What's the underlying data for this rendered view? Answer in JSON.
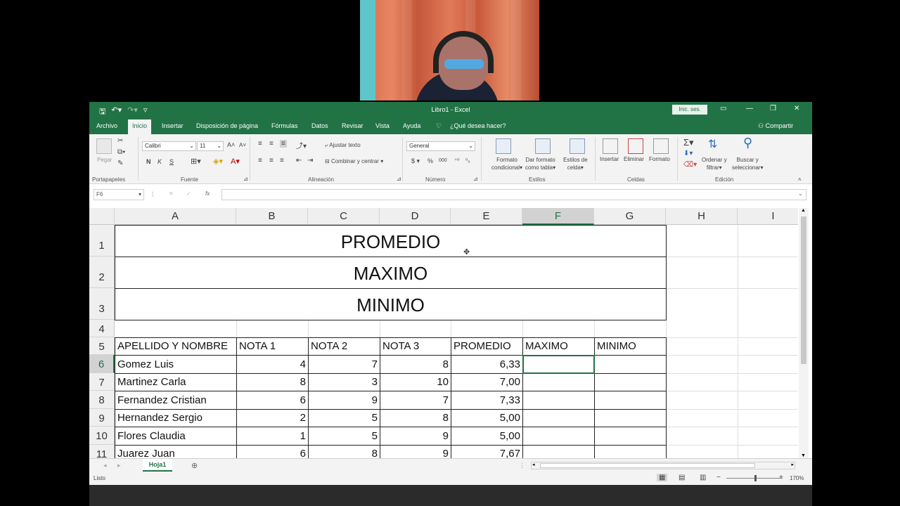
{
  "window": {
    "title": "Libro1 - Excel",
    "signin": "Inic. ses."
  },
  "tabs": [
    {
      "label": "Archivo"
    },
    {
      "label": "Inicio"
    },
    {
      "label": "Insertar"
    },
    {
      "label": "Disposición de página"
    },
    {
      "label": "Fórmulas"
    },
    {
      "label": "Datos"
    },
    {
      "label": "Revisar"
    },
    {
      "label": "Vista"
    },
    {
      "label": "Ayuda"
    },
    {
      "label": "¿Qué desea hacer?"
    }
  ],
  "share": "Compartir",
  "ribbon": {
    "clipboard": {
      "paste": "Pegar",
      "label": "Portapapeles"
    },
    "font": {
      "family": "Calibri",
      "size": "11",
      "bold": "N",
      "italic": "K",
      "underline": "S",
      "label": "Fuente"
    },
    "alignment": {
      "wrap": "Ajustar texto",
      "merge": "Combinar y centrar",
      "label": "Alineación"
    },
    "number": {
      "format": "General",
      "label": "Número"
    },
    "styles": {
      "conditional": [
        "Formato",
        "condicional"
      ],
      "table": [
        "Dar formato",
        "como tabla"
      ],
      "cell": [
        "Estilos de",
        "celda"
      ],
      "label": "Estilos"
    },
    "cells": {
      "insert": "Insertar",
      "delete": "Eliminar",
      "format": "Formato",
      "label": "Celdas"
    },
    "editing": {
      "sort": [
        "Ordenar y",
        "filtrar"
      ],
      "find": [
        "Buscar y",
        "seleccionar"
      ],
      "label": "Edición"
    }
  },
  "formula_bar": {
    "name_box": "F6",
    "formula": ""
  },
  "columns": [
    "A",
    "B",
    "C",
    "D",
    "E",
    "F",
    "G",
    "H",
    "I"
  ],
  "selected_cell": "F6",
  "merged": {
    "r1": "PROMEDIO",
    "r2": "MAXIMO",
    "r3": "MINIMO"
  },
  "table": {
    "headers": [
      "APELLIDO Y NOMBRE",
      "NOTA 1",
      "NOTA 2",
      "NOTA 3",
      "PROMEDIO",
      "MAXIMO",
      "MINIMO"
    ],
    "rows": [
      {
        "name": "Gomez Luis",
        "n1": "4",
        "n2": "7",
        "n3": "8",
        "prom": "6,33"
      },
      {
        "name": "Martinez Carla",
        "n1": "8",
        "n2": "3",
        "n3": "10",
        "prom": "7,00"
      },
      {
        "name": "Fernandez Cristian",
        "n1": "6",
        "n2": "9",
        "n3": "7",
        "prom": "7,33"
      },
      {
        "name": "Hernandez Sergio",
        "n1": "2",
        "n2": "5",
        "n3": "8",
        "prom": "5,00"
      },
      {
        "name": "Flores Claudia",
        "n1": "1",
        "n2": "5",
        "n3": "9",
        "prom": "5,00"
      },
      {
        "name": "Juarez Juan",
        "n1": "6",
        "n2": "8",
        "n3": "9",
        "prom": "7,67"
      }
    ]
  },
  "row_numbers": [
    "1",
    "2",
    "3",
    "4",
    "5",
    "6",
    "7",
    "8",
    "9",
    "10",
    "11"
  ],
  "sheet": {
    "tab": "Hoja1"
  },
  "status": {
    "ready": "Listo",
    "zoom": "170%"
  }
}
